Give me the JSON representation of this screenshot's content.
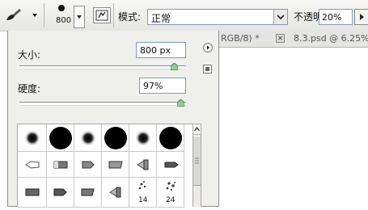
{
  "toolbar": {
    "preset_size": "800",
    "mode_label": "模式:",
    "mode_value": "正常",
    "opacity_label": "不透明度:",
    "opacity_value": "20%"
  },
  "brush_panel": {
    "size_label": "大小:",
    "size_value": "800 px",
    "size_slider_fraction": 0.87,
    "hardness_label": "硬度:",
    "hardness_value": "97%",
    "hardness_slider_fraction": 0.97,
    "presets": [
      {
        "label": "",
        "icon": "soft-round-brush-icon"
      },
      {
        "label": "",
        "icon": "hard-round-brush-icon"
      },
      {
        "label": "",
        "icon": "soft-round-brush-icon"
      },
      {
        "label": "",
        "icon": "hard-round-brush-icon"
      },
      {
        "label": "",
        "icon": "soft-round-brush-icon"
      },
      {
        "label": "",
        "icon": "hard-round-brush-icon"
      },
      {
        "label": "",
        "icon": "chalk-brush-icon"
      },
      {
        "label": "",
        "icon": "flat-brush-icon"
      },
      {
        "label": "",
        "icon": "flat-brush-icon"
      },
      {
        "label": "",
        "icon": "flat-brush-icon"
      },
      {
        "label": "",
        "icon": "airbrush-icon"
      },
      {
        "label": "",
        "icon": "marker-brush-icon"
      },
      {
        "label": "",
        "icon": "flat-brush-icon"
      },
      {
        "label": "",
        "icon": "marker-brush-icon"
      },
      {
        "label": "",
        "icon": "flat-brush-icon"
      },
      {
        "label": "",
        "icon": "airbrush-icon"
      },
      {
        "label": "14",
        "icon": "scatter-brush-icon"
      },
      {
        "label": "24",
        "icon": "scatter-brush-icon"
      }
    ]
  },
  "document_tabs": [
    {
      "label": "RGB/8) *"
    },
    {
      "label": "8.3.psd @ 6.25%"
    }
  ],
  "colors": {
    "panel_bg": "#efefeb",
    "toolbar_bg": "#ececea",
    "field_border": "#7f9db9",
    "slider_thumb": "#8fce8f"
  }
}
